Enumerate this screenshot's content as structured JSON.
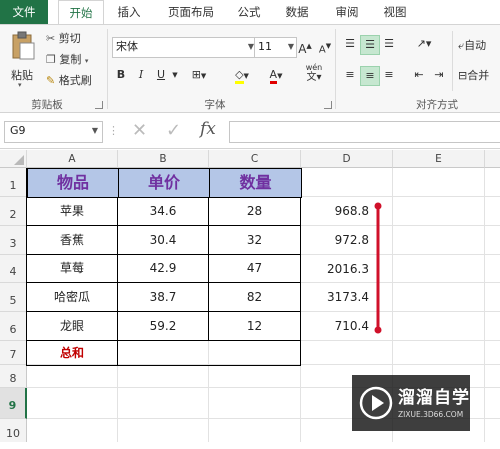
{
  "tabs": [
    "文件",
    "开始",
    "插入",
    "页面布局",
    "公式",
    "数据",
    "审阅",
    "视图"
  ],
  "clipboard": {
    "paste": "粘贴",
    "cut": "剪切",
    "copy": "复制",
    "format_painter": "格式刷",
    "label": "剪贴板"
  },
  "font": {
    "name": "宋体",
    "size": "11",
    "grow": "A",
    "shrink": "A",
    "bold": "B",
    "italic": "I",
    "underline": "U",
    "font_color_letter": "A",
    "label": "字体",
    "wen_icon": "wén"
  },
  "alignment": {
    "label": "对齐方式",
    "wrap": "自动",
    "merge": "合并"
  },
  "formula_bar": {
    "name_box": "G9",
    "fx": "fx",
    "value": ""
  },
  "columns": [
    "A",
    "B",
    "C",
    "D",
    "E"
  ],
  "rows": [
    "1",
    "2",
    "3",
    "4",
    "5",
    "6",
    "7",
    "8",
    "9",
    "10"
  ],
  "table": {
    "headers": [
      "物品",
      "单价",
      "数量"
    ],
    "rows": [
      [
        "苹果",
        "34.6",
        "28"
      ],
      [
        "香蕉",
        "30.4",
        "32"
      ],
      [
        "草莓",
        "42.9",
        "47"
      ],
      [
        "哈密瓜",
        "38.7",
        "82"
      ],
      [
        "龙眼",
        "59.2",
        "12"
      ]
    ],
    "total_label": "总和"
  },
  "products": [
    "968.8",
    "972.8",
    "2016.3",
    "3173.4",
    "710.4"
  ],
  "watermark": {
    "brand": "溜溜自学",
    "url": "ZIXUE.3D66.COM"
  },
  "colors": {
    "accent": "#217346",
    "header_fill": "#b4c6e7",
    "header_text": "#7030a0",
    "total_text": "#c00000",
    "bracket": "#d0102a"
  }
}
